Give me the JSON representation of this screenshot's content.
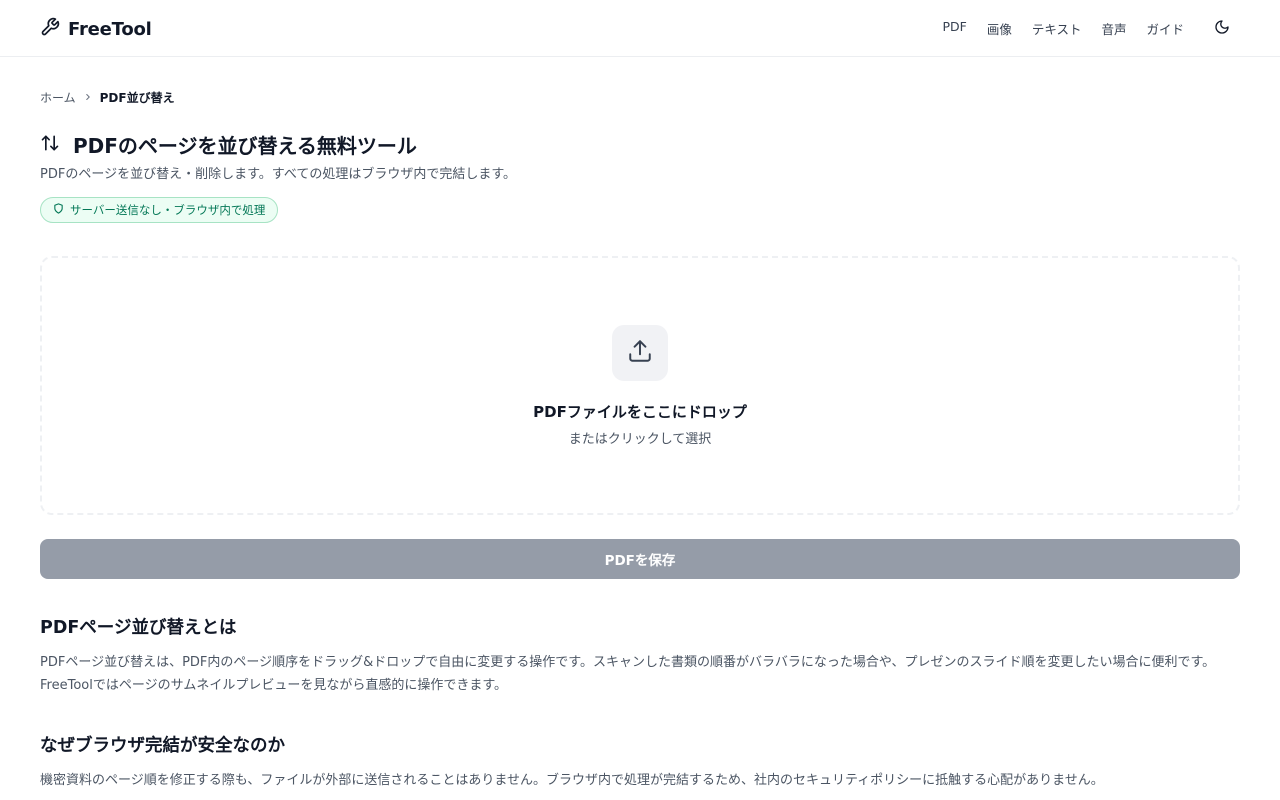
{
  "header": {
    "logo_text": "FreeTool",
    "nav": [
      "PDF",
      "画像",
      "テキスト",
      "音声",
      "ガイド"
    ]
  },
  "breadcrumb": {
    "home": "ホーム",
    "current": "PDF並び替え"
  },
  "page": {
    "title": "PDFのページを並び替える無料ツール",
    "subtitle": "PDFのページを並び替え・削除します。すべての処理はブラウザ内で完結します。",
    "badge": "サーバー送信なし・ブラウザ内で処理"
  },
  "dropzone": {
    "title": "PDFファイルをここにドロップ",
    "subtitle": "またはクリックして選択"
  },
  "save_button": "PDFを保存",
  "sections": [
    {
      "title": "PDFページ並び替えとは",
      "body": "PDFページ並び替えは、PDF内のページ順序をドラッグ&ドロップで自由に変更する操作です。スキャンした書類の順番がバラバラになった場合や、プレゼンのスライド順を変更したい場合に便利です。FreeToolではページのサムネイルプレビューを見ながら直感的に操作できます。"
    },
    {
      "title": "なぜブラウザ完結が安全なのか",
      "body": "機密資料のページ順を修正する際も、ファイルが外部に送信されることはありません。ブラウザ内で処理が完結するため、社内のセキュリティポリシーに抵触する心配がありません。"
    }
  ],
  "colors": {
    "badge_green": "#047857",
    "button_disabled": "#959ca8"
  }
}
